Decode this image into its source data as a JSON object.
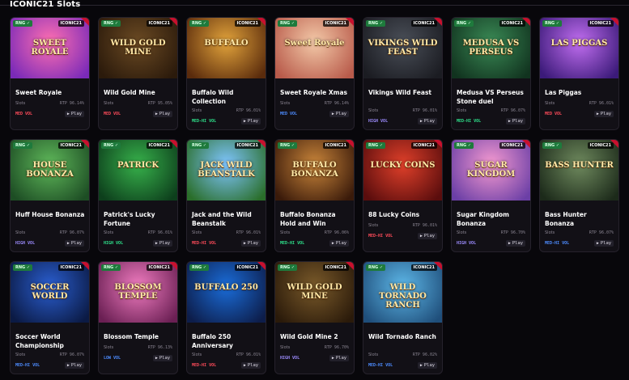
{
  "section": {
    "title": "ICONIC21 Slots"
  },
  "badges": {
    "rng": "RNG ✓",
    "brand": "ICONIC21"
  },
  "play_label": "Play",
  "games": [
    {
      "name": "Sweet Royale",
      "logo": "SWEET ROYALE",
      "category": "Slots",
      "rtp": "RTP 96.14%",
      "vol": "MED VOL",
      "vol_class": "vol-red",
      "art": [
        "#ff6fb1",
        "#7a2ab8"
      ]
    },
    {
      "name": "Wild Gold Mine",
      "logo": "WILD GOLD MINE",
      "category": "Slots",
      "rtp": "RTP 95.05%",
      "vol": "MED VOL",
      "vol_class": "vol-red",
      "art": [
        "#6b4a23",
        "#2b1a0b"
      ]
    },
    {
      "name": "Buffalo Wild Collection",
      "logo": "BUFFALO",
      "category": "Slots",
      "rtp": "RTP 96.01%",
      "vol": "MED-HI VOL",
      "vol_class": "vol-green",
      "art": [
        "#e2a33b",
        "#5a2b0c"
      ]
    },
    {
      "name": "Sweet Royale Xmas",
      "logo": "Sweet Royale",
      "category": "Slots",
      "rtp": "RTP 96.14%",
      "vol": "MED VOL",
      "vol_class": "vol-blue",
      "art": [
        "#f3c9a8",
        "#b85a4a"
      ]
    },
    {
      "name": "Vikings Wild Feast",
      "logo": "VIKINGS WILD FEAST",
      "category": "Slots",
      "rtp": "RTP 96.01%",
      "vol": "HIGH VOL",
      "vol_class": "vol-purple",
      "art": [
        "#4a4f58",
        "#1b1c22"
      ]
    },
    {
      "name": "Medusa VS Perseus Stone duel",
      "logo": "MEDUSA VS PERSEUS",
      "category": "Slots",
      "rtp": "RTP 96.07%",
      "vol": "MED-HI VOL",
      "vol_class": "vol-green",
      "art": [
        "#3a8a55",
        "#11331f"
      ]
    },
    {
      "name": "Las Piggas",
      "logo": "LAS PIGGAS",
      "category": "Slots",
      "rtp": "RTP 96.01%",
      "vol": "MED VOL",
      "vol_class": "vol-red",
      "art": [
        "#c16ef0",
        "#3b1a79"
      ]
    },
    {
      "name": "Huff House Bonanza",
      "logo": "HOUSE BONANZA",
      "category": "Slots",
      "rtp": "RTP 96.07%",
      "vol": "HIGH VOL",
      "vol_class": "vol-purple",
      "art": [
        "#5fb85a",
        "#1d4d24"
      ]
    },
    {
      "name": "Patrick's Lucky Fortune",
      "logo": "PATRICK",
      "category": "Slots",
      "rtp": "RTP 96.01%",
      "vol": "HIGH VOL",
      "vol_class": "vol-green",
      "art": [
        "#37b14b",
        "#0d3f1c"
      ]
    },
    {
      "name": "Jack and the Wild Beanstalk",
      "logo": "JACK WILD BEANSTALK",
      "category": "Slots",
      "rtp": "RTP 96.01%",
      "vol": "MED-HI VOL",
      "vol_class": "vol-red",
      "art": [
        "#7fc5ff",
        "#2a6e2a"
      ]
    },
    {
      "name": "Buffalo Bonanza Hold and Win",
      "logo": "BUFFALO BONANZA",
      "category": "Slots",
      "rtp": "RTP 96.06%",
      "vol": "MED-HI VOL",
      "vol_class": "vol-green",
      "art": [
        "#c9853a",
        "#3a1a0a"
      ]
    },
    {
      "name": "88 Lucky Coins",
      "logo": "LUCKY COINS",
      "category": "Slots",
      "rtp": "RTP 96.01%",
      "vol": "MED-HI VOL",
      "vol_class": "vol-red",
      "art": [
        "#e0402a",
        "#5a0d0d"
      ]
    },
    {
      "name": "Sugar Kingdom Bonanza",
      "logo": "SUGAR KINGDOM",
      "category": "Slots",
      "rtp": "RTP 96.70%",
      "vol": "HIGH VOL",
      "vol_class": "vol-purple",
      "art": [
        "#f59ad0",
        "#6b3fa6"
      ]
    },
    {
      "name": "Bass Hunter Bonanza",
      "logo": "BASS HUNTER",
      "category": "Slots",
      "rtp": "RTP 96.07%",
      "vol": "MED-HI VOL",
      "vol_class": "vol-blue",
      "art": [
        "#6f8a5e",
        "#1c2a1a"
      ]
    },
    {
      "name": "Soccer World Championship",
      "logo": "SOCCER WORLD",
      "category": "Slots",
      "rtp": "RTP 96.07%",
      "vol": "MED-HI VOL",
      "vol_class": "vol-blue",
      "art": [
        "#2a5ed0",
        "#0b1a44"
      ]
    },
    {
      "name": "Blossom Temple",
      "logo": "BLOSSOM TEMPLE",
      "category": "Slots",
      "rtp": "RTP 96.13%",
      "vol": "LOW VOL",
      "vol_class": "vol-blue",
      "art": [
        "#f07cc0",
        "#6a1f53"
      ]
    },
    {
      "name": "Buffalo 250 Anniversary",
      "logo": "BUFFALO 250",
      "category": "Slots",
      "rtp": "RTP 96.01%",
      "vol": "MED-HI VOL",
      "vol_class": "vol-red",
      "art": [
        "#1a6cd8",
        "#0d1d4a"
      ]
    },
    {
      "name": "Wild Gold Mine 2",
      "logo": "WILD GOLD MINE",
      "category": "Slots",
      "rtp": "RTP 96.70%",
      "vol": "HIGH VOL",
      "vol_class": "vol-purple",
      "art": [
        "#7a5a2a",
        "#2a1a0a"
      ]
    },
    {
      "name": "Wild Tornado Ranch",
      "logo": "WILD TORNADO RANCH",
      "category": "Slots",
      "rtp": "RTP 96.02%",
      "vol": "MED-HI VOL",
      "vol_class": "vol-blue",
      "art": [
        "#5db7e8",
        "#1f4e7a"
      ]
    }
  ]
}
